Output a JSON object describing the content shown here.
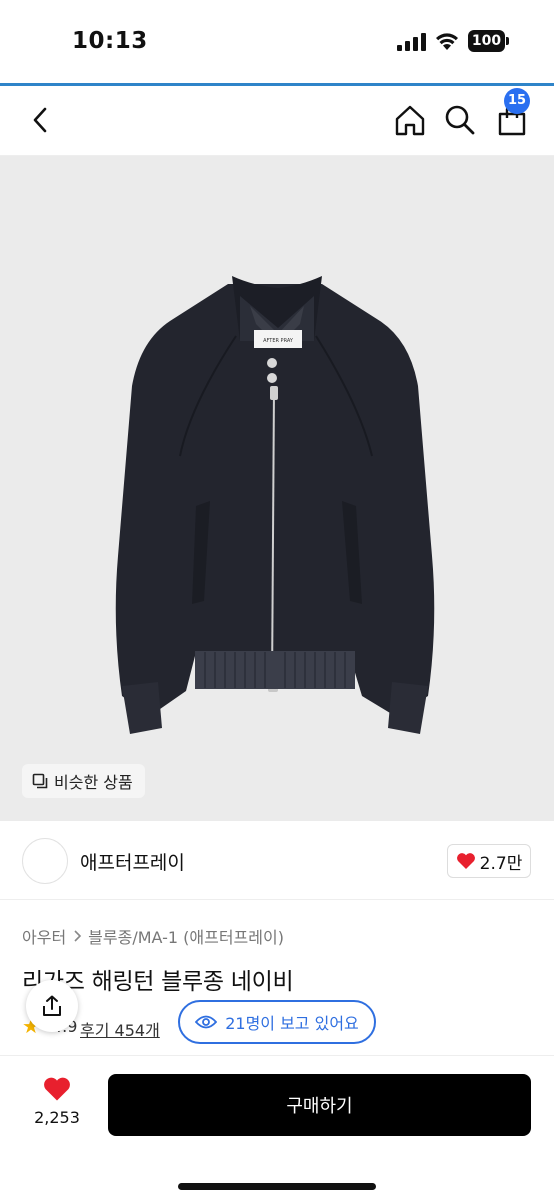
{
  "status_bar": {
    "time": "10:13",
    "battery": "100"
  },
  "nav": {
    "cart_count": "15"
  },
  "image": {
    "similar_label": "비슷한 상품",
    "tag_text": "AFTER PRAY"
  },
  "brand": {
    "logo_text": "AFTER PRAY",
    "name": "애프터프레이",
    "likes": "2.7만"
  },
  "breadcrumb": {
    "level1": "아우터",
    "level2": "블루종/MA-1 (애프터프레이)"
  },
  "product": {
    "title": "리가즈 해링턴 블루종 네이비",
    "rating": "4.9",
    "reviews": "후기 454개",
    "viewers": "21명이 보고 있어요"
  },
  "bottom": {
    "wish_count": "2,253",
    "buy_label": "구매하기"
  },
  "colors": {
    "accent": "#2f6fe0",
    "heart": "#e8202e",
    "jacket": "#23252e",
    "background": "#ebebeb"
  },
  "icons": [
    "back-icon",
    "home-icon",
    "search-icon",
    "cart-icon",
    "similar-icon",
    "heart-icon",
    "star-icon",
    "eye-icon",
    "share-icon"
  ]
}
